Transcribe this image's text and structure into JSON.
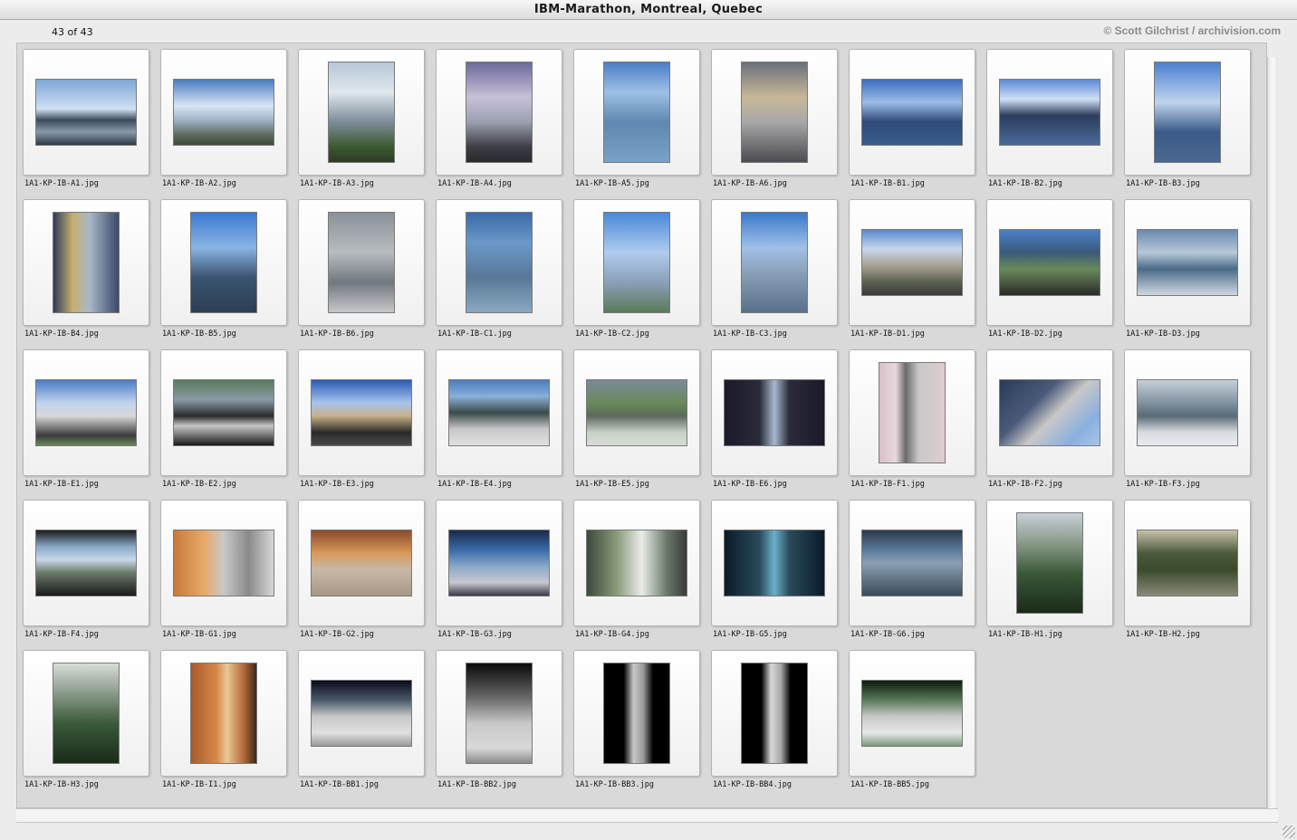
{
  "window": {
    "title": "IBM-Marathon, Montreal, Quebec",
    "count": "43 of 43",
    "credit": "© Scott Gilchrist / archivision.com"
  },
  "thumbnails": [
    {
      "label": "1A1-KP-IB-A1.jpg",
      "orientation": "landscape",
      "tone": "linear-gradient(#7fa6d8 0%, #cfe0f2 45%, #3b4a5a 62%, #8a9aaa 80%, #2d3a48 100%)"
    },
    {
      "label": "1A1-KP-IB-A2.jpg",
      "orientation": "landscape",
      "tone": "linear-gradient(#4a7cc0 0%, #d8e6f4 40%, #9fb3c6 62%, #5c6a5c 85%, #3e4a3a 100%)"
    },
    {
      "label": "1A1-KP-IB-A3.jpg",
      "orientation": "portrait",
      "tone": "linear-gradient(#b8c8d8 0%, #dfe7ee 30%, #7c8b98 60%, #3b5a2e 85%, #2c3a26 100%)"
    },
    {
      "label": "1A1-KP-IB-A4.jpg",
      "orientation": "portrait",
      "tone": "linear-gradient(#6a6a9a 0%, #c8c0d8 35%, #9aa0b0 60%, #3c3c44 85%, #2a2a2e 100%)"
    },
    {
      "label": "1A1-KP-IB-A5.jpg",
      "orientation": "portrait",
      "tone": "linear-gradient(#4a7ec8 0%, #9ec0e6 30%, #5f88b0 60%, #7aa2c8 100%)"
    },
    {
      "label": "1A1-KP-IB-A6.jpg",
      "orientation": "portrait",
      "tone": "linear-gradient(#6a707c 0%, #c8b898 35%, #a8a8a8 60%, #4a4a50 100%)"
    },
    {
      "label": "1A1-KP-IB-B1.jpg",
      "orientation": "landscape",
      "tone": "linear-gradient(#3c6ec0 0%, #9cbce6 35%, #2e4a78 65%, #3a5c8c 100%)"
    },
    {
      "label": "1A1-KP-IB-B2.jpg",
      "orientation": "landscape",
      "tone": "linear-gradient(#5a8ad6 0%, #d0e0f6 30%, #2c3c5c 55%, #4a6a9a 100%)"
    },
    {
      "label": "1A1-KP-IB-B3.jpg",
      "orientation": "portrait",
      "tone": "linear-gradient(#4a80d0 0%, #c0d4ee 40%, #3a5a88 70%, #4a6890 100%)"
    },
    {
      "label": "1A1-KP-IB-B4.jpg",
      "orientation": "portrait",
      "tone": "linear-gradient(90deg, #2c3a5a 0%, #c8b070 30%, #a8b8c8 55%, #3a4a6a 100%)"
    },
    {
      "label": "1A1-KP-IB-B5.jpg",
      "orientation": "portrait",
      "tone": "linear-gradient(#3a78d0 0%, #8ab4e4 35%, #3a5470 65%, #2c3e54 100%)"
    },
    {
      "label": "1A1-KP-IB-B6.jpg",
      "orientation": "portrait",
      "tone": "linear-gradient(#8a9098 0%, #b8bcc0 40%, #707880 70%, #c8c8c8 100%)"
    },
    {
      "label": "1A1-KP-IB-C1.jpg",
      "orientation": "portrait",
      "tone": "linear-gradient(#3a6aa8 0%, #6a98c8 30%, #587898 65%, #8aa8c0 100%)"
    },
    {
      "label": "1A1-KP-IB-C2.jpg",
      "orientation": "portrait",
      "tone": "linear-gradient(#4a88d8 0%, #b0ccee 40%, #8aa0b8 70%, #5a7a5a 100%)"
    },
    {
      "label": "1A1-KP-IB-C3.jpg",
      "orientation": "portrait",
      "tone": "linear-gradient(#3a78c8 0%, #a0c0e8 35%, #8aa0b8 60%, #5a7088 100%)"
    },
    {
      "label": "1A1-KP-IB-D1.jpg",
      "orientation": "landscape",
      "tone": "linear-gradient(#5a8ad0 0%, #c8d8ec 30%, #a8a090 55%, #5a6050 80%, #3a3a3a 100%)"
    },
    {
      "label": "1A1-KP-IB-D2.jpg",
      "orientation": "landscape",
      "tone": "linear-gradient(#4a80c8 0%, #3a5a78 35%, #6a8a5a 60%, #2a2a2a 100%)"
    },
    {
      "label": "1A1-KP-IB-D3.jpg",
      "orientation": "landscape",
      "tone": "linear-gradient(#6a8ab0 0%, #b8c8d8 35%, #4a6a88 60%, #d0d8e0 100%)"
    },
    {
      "label": "1A1-KP-IB-E1.jpg",
      "orientation": "landscape",
      "tone": "linear-gradient(#4a7cc8 0%, #c0d4ec 35%, #d8d8d8 55%, #3a3a3a 85%, #6a8a5a 100%)"
    },
    {
      "label": "1A1-KP-IB-E2.jpg",
      "orientation": "landscape",
      "tone": "linear-gradient(#5a7a5a 0%, #8a9aa8 30%, #2a2a2a 55%, #c8c8c8 70%, #1a1a1a 100%)"
    },
    {
      "label": "1A1-KP-IB-E3.jpg",
      "orientation": "landscape",
      "tone": "linear-gradient(#2a5ab8 0%, #a8c4ec 35%, #c8b088 55%, #2a2a2a 80%, #4a4a4a 100%)"
    },
    {
      "label": "1A1-KP-IB-E4.jpg",
      "orientation": "landscape",
      "tone": "linear-gradient(#4a7cc0 0%, #8ab0d8 25%, #3a4a4a 50%, #c8c8c8 75%, #e0e0e0 100%)"
    },
    {
      "label": "1A1-KP-IB-E5.jpg",
      "orientation": "landscape",
      "tone": "linear-gradient(#7a8a9a 0%, #6a8a5a 35%, #5a6a5a 55%, #c8d0c8 80%, #d8dcd8 100%)"
    },
    {
      "label": "1A1-KP-IB-E6.jpg",
      "orientation": "landscape",
      "tone": "linear-gradient(90deg, #1a1a2a 0%, #2a2a3a 35%, #a8b8d0 50%, #2a2a3a 65%, #1a1a2a 100%)"
    },
    {
      "label": "1A1-KP-IB-F1.jpg",
      "orientation": "portrait",
      "tone": "linear-gradient(90deg, #d8c0c8 0%, #e8d8dc 25%, #6a6a6a 40%, #c8c8c8 60%, #e0ccd0 100%)"
    },
    {
      "label": "1A1-KP-IB-F2.jpg",
      "orientation": "landscape",
      "tone": "linear-gradient(135deg, #2a3a5a 0%, #4a5a78 35%, #c8c8c8 55%, #8ab0e0 80%, #a8c4e8 100%)"
    },
    {
      "label": "1A1-KP-IB-F3.jpg",
      "orientation": "landscape",
      "tone": "linear-gradient(#c8d0d8 0%, #8a9aa8 30%, #5a6a78 55%, #d8dce0 80%, #e8ecf0 100%)"
    },
    {
      "label": "1A1-KP-IB-F4.jpg",
      "orientation": "landscape",
      "tone": "linear-gradient(#1a1a1a 0%, #8aa8c8 25%, #c8d8e8 45%, #6a7a6a 65%, #1a1a1a 100%)"
    },
    {
      "label": "1A1-KP-IB-G1.jpg",
      "orientation": "landscape",
      "tone": "linear-gradient(90deg, #c87a3a 0%, #e8a868 30%, #c8c8c8 50%, #8a8a8a 75%, #d8d8d8 100%)"
    },
    {
      "label": "1A1-KP-IB-G2.jpg",
      "orientation": "landscape",
      "tone": "linear-gradient(#8a4a2a 0%, #d89a5a 35%, #c8b8a8 60%, #a89888 100%)"
    },
    {
      "label": "1A1-KP-IB-G3.jpg",
      "orientation": "landscape",
      "tone": "linear-gradient(#1a2a4a 0%, #3a6aa8 30%, #8aa8c8 55%, #c8c8d0 80%, #3a3a4a 100%)"
    },
    {
      "label": "1A1-KP-IB-G4.jpg",
      "orientation": "landscape",
      "tone": "linear-gradient(90deg, #3a4a3a 0%, #8a9a7a 30%, #e8ece8 55%, #6a7a6a 80%, #3a3a3a 100%)"
    },
    {
      "label": "1A1-KP-IB-G5.jpg",
      "orientation": "landscape",
      "tone": "linear-gradient(90deg, #0a1a2a 0%, #2a4a5a 35%, #6ab0c8 50%, #2a4a5a 65%, #0a1a2a 100%)"
    },
    {
      "label": "1A1-KP-IB-G6.jpg",
      "orientation": "landscape",
      "tone": "linear-gradient(#2a3a4a 0%, #5a7a9a 30%, #8aa0b4 50%, #3a4a5a 100%)"
    },
    {
      "label": "1A1-KP-IB-H1.jpg",
      "orientation": "portrait",
      "tone": "linear-gradient(#c8d0d8 0%, #8a9a8a 30%, #3a5a3a 60%, #1a2a1a 100%)"
    },
    {
      "label": "1A1-KP-IB-H2.jpg",
      "orientation": "landscape",
      "tone": "linear-gradient(#c8c0a8 0%, #4a5a3a 35%, #3a4a2a 60%, #8a8a7a 100%)"
    },
    {
      "label": "1A1-KP-IB-H3.jpg",
      "orientation": "portrait",
      "tone": "linear-gradient(#d8dcd8 0%, #8a9a8a 30%, #3a5a3a 60%, #1a2a1a 100%)"
    },
    {
      "label": "1A1-KP-IB-I1.jpg",
      "orientation": "portrait",
      "tone": "linear-gradient(90deg, #a85a2a 0%, #d88a4a 40%, #e8c898 55%, #b86a3a 80%, #3a2a1a 100%)"
    },
    {
      "label": "1A1-KP-IB-BB1.jpg",
      "orientation": "landscape",
      "tone": "linear-gradient(#0a0a1a 0%, #4a5a6a 30%, #c8c8c8 55%, #e0e0e0 80%, #9a9a9a 100%)"
    },
    {
      "label": "1A1-KP-IB-BB2.jpg",
      "orientation": "portrait",
      "tone": "linear-gradient(#0a0a0a 0%, #6a6a6a 35%, #c8c8c8 60%, #d8d8d8 85%, #8a8a8a 100%)"
    },
    {
      "label": "1A1-KP-IB-BB3.jpg",
      "orientation": "portrait",
      "tone": "linear-gradient(90deg, #000000 0%, #000000 30%, #c8c8c8 45%, #9a9a9a 60%, #000000 75%, #000000 100%)"
    },
    {
      "label": "1A1-KP-IB-BB4.jpg",
      "orientation": "portrait",
      "tone": "linear-gradient(90deg, #000000 0%, #000000 30%, #d8d8d8 45%, #a8a8a8 60%, #000000 75%, #000000 100%)"
    },
    {
      "label": "1A1-KP-IB-BB5.jpg",
      "orientation": "landscape",
      "tone": "linear-gradient(#0a1a0a 0%, #5a7a5a 30%, #c8c8c8 55%, #e8e8e8 80%, #7a9a7a 100%)"
    }
  ]
}
